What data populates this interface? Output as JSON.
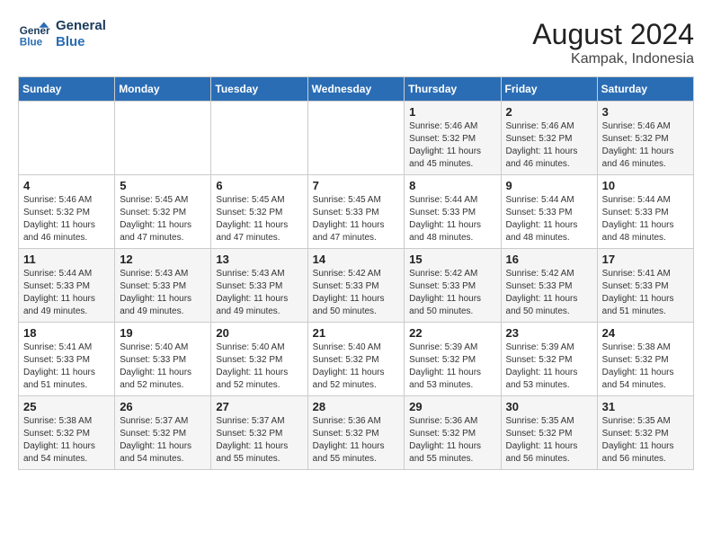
{
  "logo": {
    "line1": "General",
    "line2": "Blue"
  },
  "title": "August 2024",
  "location": "Kampak, Indonesia",
  "days_header": [
    "Sunday",
    "Monday",
    "Tuesday",
    "Wednesday",
    "Thursday",
    "Friday",
    "Saturday"
  ],
  "weeks": [
    [
      {
        "day": "",
        "detail": ""
      },
      {
        "day": "",
        "detail": ""
      },
      {
        "day": "",
        "detail": ""
      },
      {
        "day": "",
        "detail": ""
      },
      {
        "day": "1",
        "detail": "Sunrise: 5:46 AM\nSunset: 5:32 PM\nDaylight: 11 hours\nand 45 minutes."
      },
      {
        "day": "2",
        "detail": "Sunrise: 5:46 AM\nSunset: 5:32 PM\nDaylight: 11 hours\nand 46 minutes."
      },
      {
        "day": "3",
        "detail": "Sunrise: 5:46 AM\nSunset: 5:32 PM\nDaylight: 11 hours\nand 46 minutes."
      }
    ],
    [
      {
        "day": "4",
        "detail": "Sunrise: 5:46 AM\nSunset: 5:32 PM\nDaylight: 11 hours\nand 46 minutes."
      },
      {
        "day": "5",
        "detail": "Sunrise: 5:45 AM\nSunset: 5:32 PM\nDaylight: 11 hours\nand 47 minutes."
      },
      {
        "day": "6",
        "detail": "Sunrise: 5:45 AM\nSunset: 5:32 PM\nDaylight: 11 hours\nand 47 minutes."
      },
      {
        "day": "7",
        "detail": "Sunrise: 5:45 AM\nSunset: 5:33 PM\nDaylight: 11 hours\nand 47 minutes."
      },
      {
        "day": "8",
        "detail": "Sunrise: 5:44 AM\nSunset: 5:33 PM\nDaylight: 11 hours\nand 48 minutes."
      },
      {
        "day": "9",
        "detail": "Sunrise: 5:44 AM\nSunset: 5:33 PM\nDaylight: 11 hours\nand 48 minutes."
      },
      {
        "day": "10",
        "detail": "Sunrise: 5:44 AM\nSunset: 5:33 PM\nDaylight: 11 hours\nand 48 minutes."
      }
    ],
    [
      {
        "day": "11",
        "detail": "Sunrise: 5:44 AM\nSunset: 5:33 PM\nDaylight: 11 hours\nand 49 minutes."
      },
      {
        "day": "12",
        "detail": "Sunrise: 5:43 AM\nSunset: 5:33 PM\nDaylight: 11 hours\nand 49 minutes."
      },
      {
        "day": "13",
        "detail": "Sunrise: 5:43 AM\nSunset: 5:33 PM\nDaylight: 11 hours\nand 49 minutes."
      },
      {
        "day": "14",
        "detail": "Sunrise: 5:42 AM\nSunset: 5:33 PM\nDaylight: 11 hours\nand 50 minutes."
      },
      {
        "day": "15",
        "detail": "Sunrise: 5:42 AM\nSunset: 5:33 PM\nDaylight: 11 hours\nand 50 minutes."
      },
      {
        "day": "16",
        "detail": "Sunrise: 5:42 AM\nSunset: 5:33 PM\nDaylight: 11 hours\nand 50 minutes."
      },
      {
        "day": "17",
        "detail": "Sunrise: 5:41 AM\nSunset: 5:33 PM\nDaylight: 11 hours\nand 51 minutes."
      }
    ],
    [
      {
        "day": "18",
        "detail": "Sunrise: 5:41 AM\nSunset: 5:33 PM\nDaylight: 11 hours\nand 51 minutes."
      },
      {
        "day": "19",
        "detail": "Sunrise: 5:40 AM\nSunset: 5:33 PM\nDaylight: 11 hours\nand 52 minutes."
      },
      {
        "day": "20",
        "detail": "Sunrise: 5:40 AM\nSunset: 5:32 PM\nDaylight: 11 hours\nand 52 minutes."
      },
      {
        "day": "21",
        "detail": "Sunrise: 5:40 AM\nSunset: 5:32 PM\nDaylight: 11 hours\nand 52 minutes."
      },
      {
        "day": "22",
        "detail": "Sunrise: 5:39 AM\nSunset: 5:32 PM\nDaylight: 11 hours\nand 53 minutes."
      },
      {
        "day": "23",
        "detail": "Sunrise: 5:39 AM\nSunset: 5:32 PM\nDaylight: 11 hours\nand 53 minutes."
      },
      {
        "day": "24",
        "detail": "Sunrise: 5:38 AM\nSunset: 5:32 PM\nDaylight: 11 hours\nand 54 minutes."
      }
    ],
    [
      {
        "day": "25",
        "detail": "Sunrise: 5:38 AM\nSunset: 5:32 PM\nDaylight: 11 hours\nand 54 minutes."
      },
      {
        "day": "26",
        "detail": "Sunrise: 5:37 AM\nSunset: 5:32 PM\nDaylight: 11 hours\nand 54 minutes."
      },
      {
        "day": "27",
        "detail": "Sunrise: 5:37 AM\nSunset: 5:32 PM\nDaylight: 11 hours\nand 55 minutes."
      },
      {
        "day": "28",
        "detail": "Sunrise: 5:36 AM\nSunset: 5:32 PM\nDaylight: 11 hours\nand 55 minutes."
      },
      {
        "day": "29",
        "detail": "Sunrise: 5:36 AM\nSunset: 5:32 PM\nDaylight: 11 hours\nand 55 minutes."
      },
      {
        "day": "30",
        "detail": "Sunrise: 5:35 AM\nSunset: 5:32 PM\nDaylight: 11 hours\nand 56 minutes."
      },
      {
        "day": "31",
        "detail": "Sunrise: 5:35 AM\nSunset: 5:32 PM\nDaylight: 11 hours\nand 56 minutes."
      }
    ]
  ]
}
